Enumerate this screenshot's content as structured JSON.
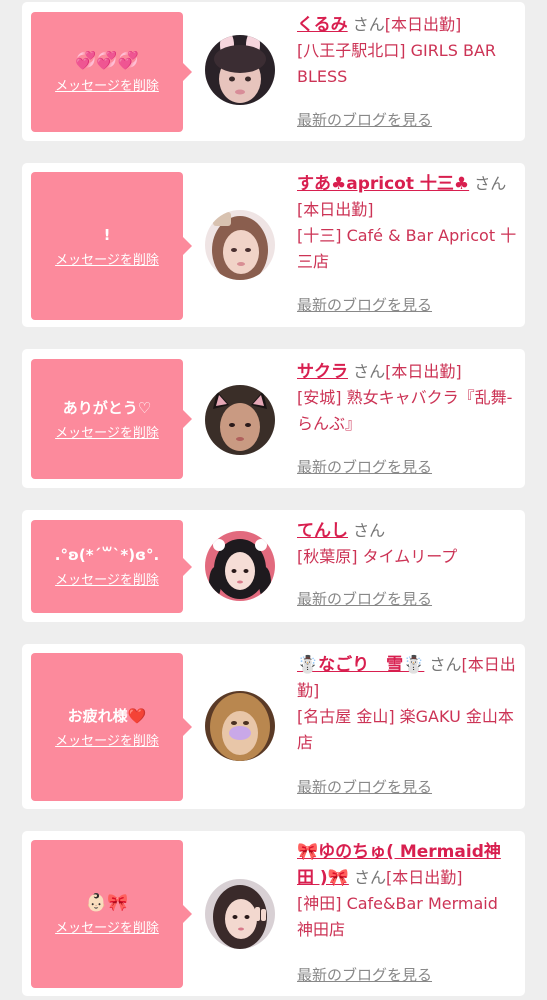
{
  "labels": {
    "delete": "メッセージを削除",
    "blog": "最新のブログを見る",
    "san": "さん"
  },
  "items": [
    {
      "message": "💞💞💞",
      "name": "くるみ",
      "status": "[本日出勤]",
      "shop": "[八王子駅北口] GIRLS BAR BLESS",
      "avatar_icon": "avatar-photo-bunny-ears"
    },
    {
      "message": "!",
      "name": "すあ♣apricot 十三♣",
      "status": "[本日出勤]",
      "shop": "[十三] Café & Bar Apricot 十三店",
      "avatar_icon": "avatar-photo"
    },
    {
      "message": "ありがとう♡",
      "name": "サクラ",
      "status": "[本日出勤]",
      "shop": "[安城] 熟女キャバクラ『乱舞-らんぶ』",
      "avatar_icon": "avatar-photo-cat-ears"
    },
    {
      "message": ".°ʚ(*´꒳`*)ɞ°.",
      "name": "てんし",
      "status": "",
      "shop": "[秋葉原] タイムリープ",
      "avatar_icon": "avatar-photo-twin-braids"
    },
    {
      "message": "お疲れ様❤️",
      "name": "☃️なごり　雪☃️",
      "status": "[本日出勤]",
      "shop": "[名古屋 金山] 楽GAKU 金山本店",
      "avatar_icon": "avatar-photo-blurred"
    },
    {
      "message": "👶🏻🎀",
      "name": "🎀ゆのちゅ( Mermaid神田 )🎀",
      "status": "[本日出勤]",
      "shop": "[神田] Cafe&Bar Mermaid 神田店",
      "avatar_icon": "avatar-photo-peace-sign"
    }
  ],
  "colors": {
    "bubble": "#fc8a9c",
    "name": "#d81f4f",
    "text": "#cc3355",
    "muted": "#888888",
    "background": "#eeeeee"
  }
}
